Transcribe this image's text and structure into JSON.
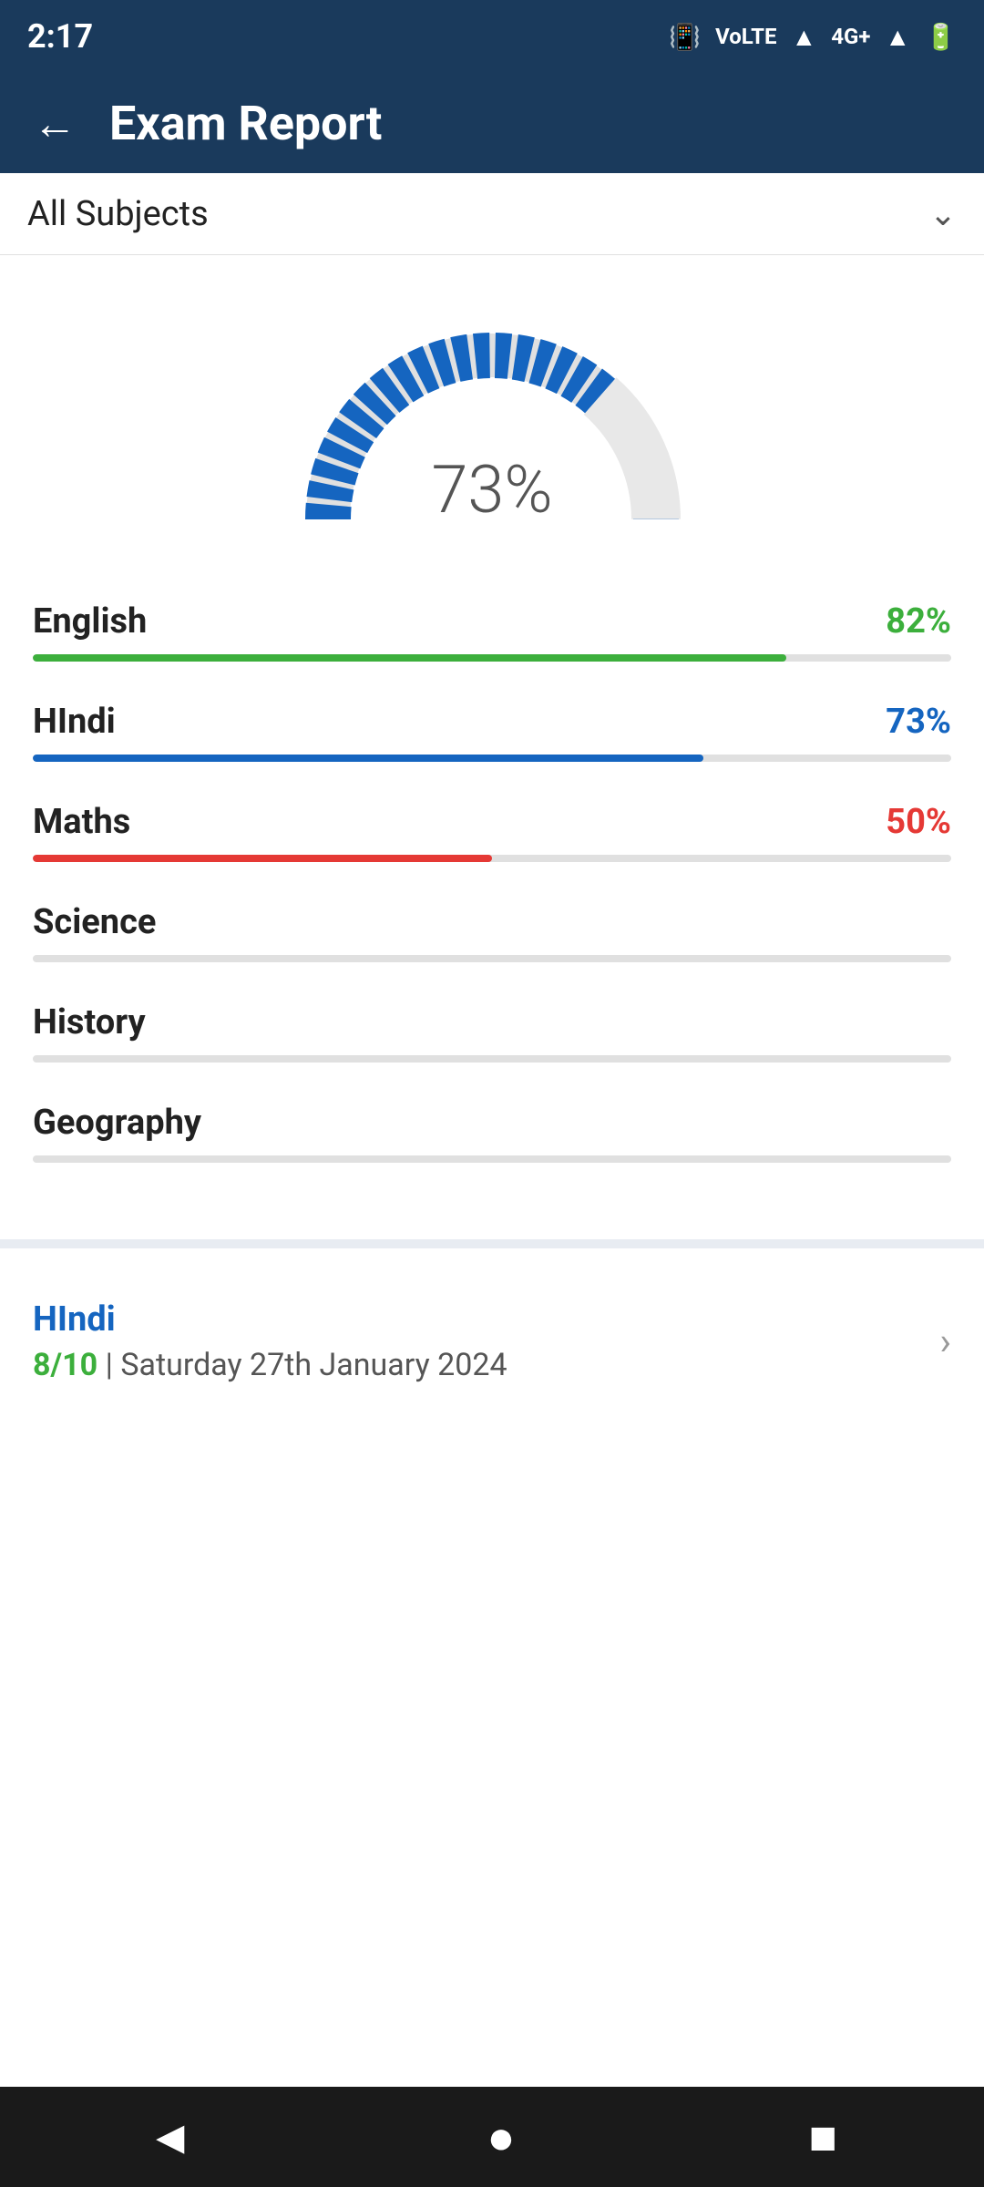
{
  "statusBar": {
    "time": "2:17",
    "icons": [
      "vibrate",
      "volte",
      "wifi",
      "4g",
      "signal",
      "battery"
    ]
  },
  "header": {
    "backLabel": "←",
    "title": "Exam Report"
  },
  "subjectDropdown": {
    "label": "All Subjects",
    "chevron": "⌄"
  },
  "gauge": {
    "percent": "73%",
    "value": 73
  },
  "subjects": [
    {
      "name": "English",
      "score": "82%",
      "value": 82,
      "colorClass": "score-green",
      "fillClass": "fill-green",
      "hasScore": true
    },
    {
      "name": "HIndi",
      "score": "73%",
      "value": 73,
      "colorClass": "score-blue",
      "fillClass": "fill-blue",
      "hasScore": true
    },
    {
      "name": "Maths",
      "score": "50%",
      "value": 50,
      "colorClass": "score-red",
      "fillClass": "fill-red",
      "hasScore": true
    },
    {
      "name": "Science",
      "score": "",
      "value": 0,
      "colorClass": "",
      "fillClass": "fill-empty",
      "hasScore": false
    },
    {
      "name": "History",
      "score": "",
      "value": 0,
      "colorClass": "",
      "fillClass": "fill-empty",
      "hasScore": false
    },
    {
      "name": "Geography",
      "score": "",
      "value": 0,
      "colorClass": "",
      "fillClass": "fill-empty",
      "hasScore": false
    }
  ],
  "examEntry": {
    "title": "HIndi",
    "score": "8/10",
    "separator": " | ",
    "date": "Saturday 27th January 2024",
    "chevron": "›"
  },
  "navBar": {
    "back": "◄",
    "home": "●",
    "recents": "■"
  }
}
